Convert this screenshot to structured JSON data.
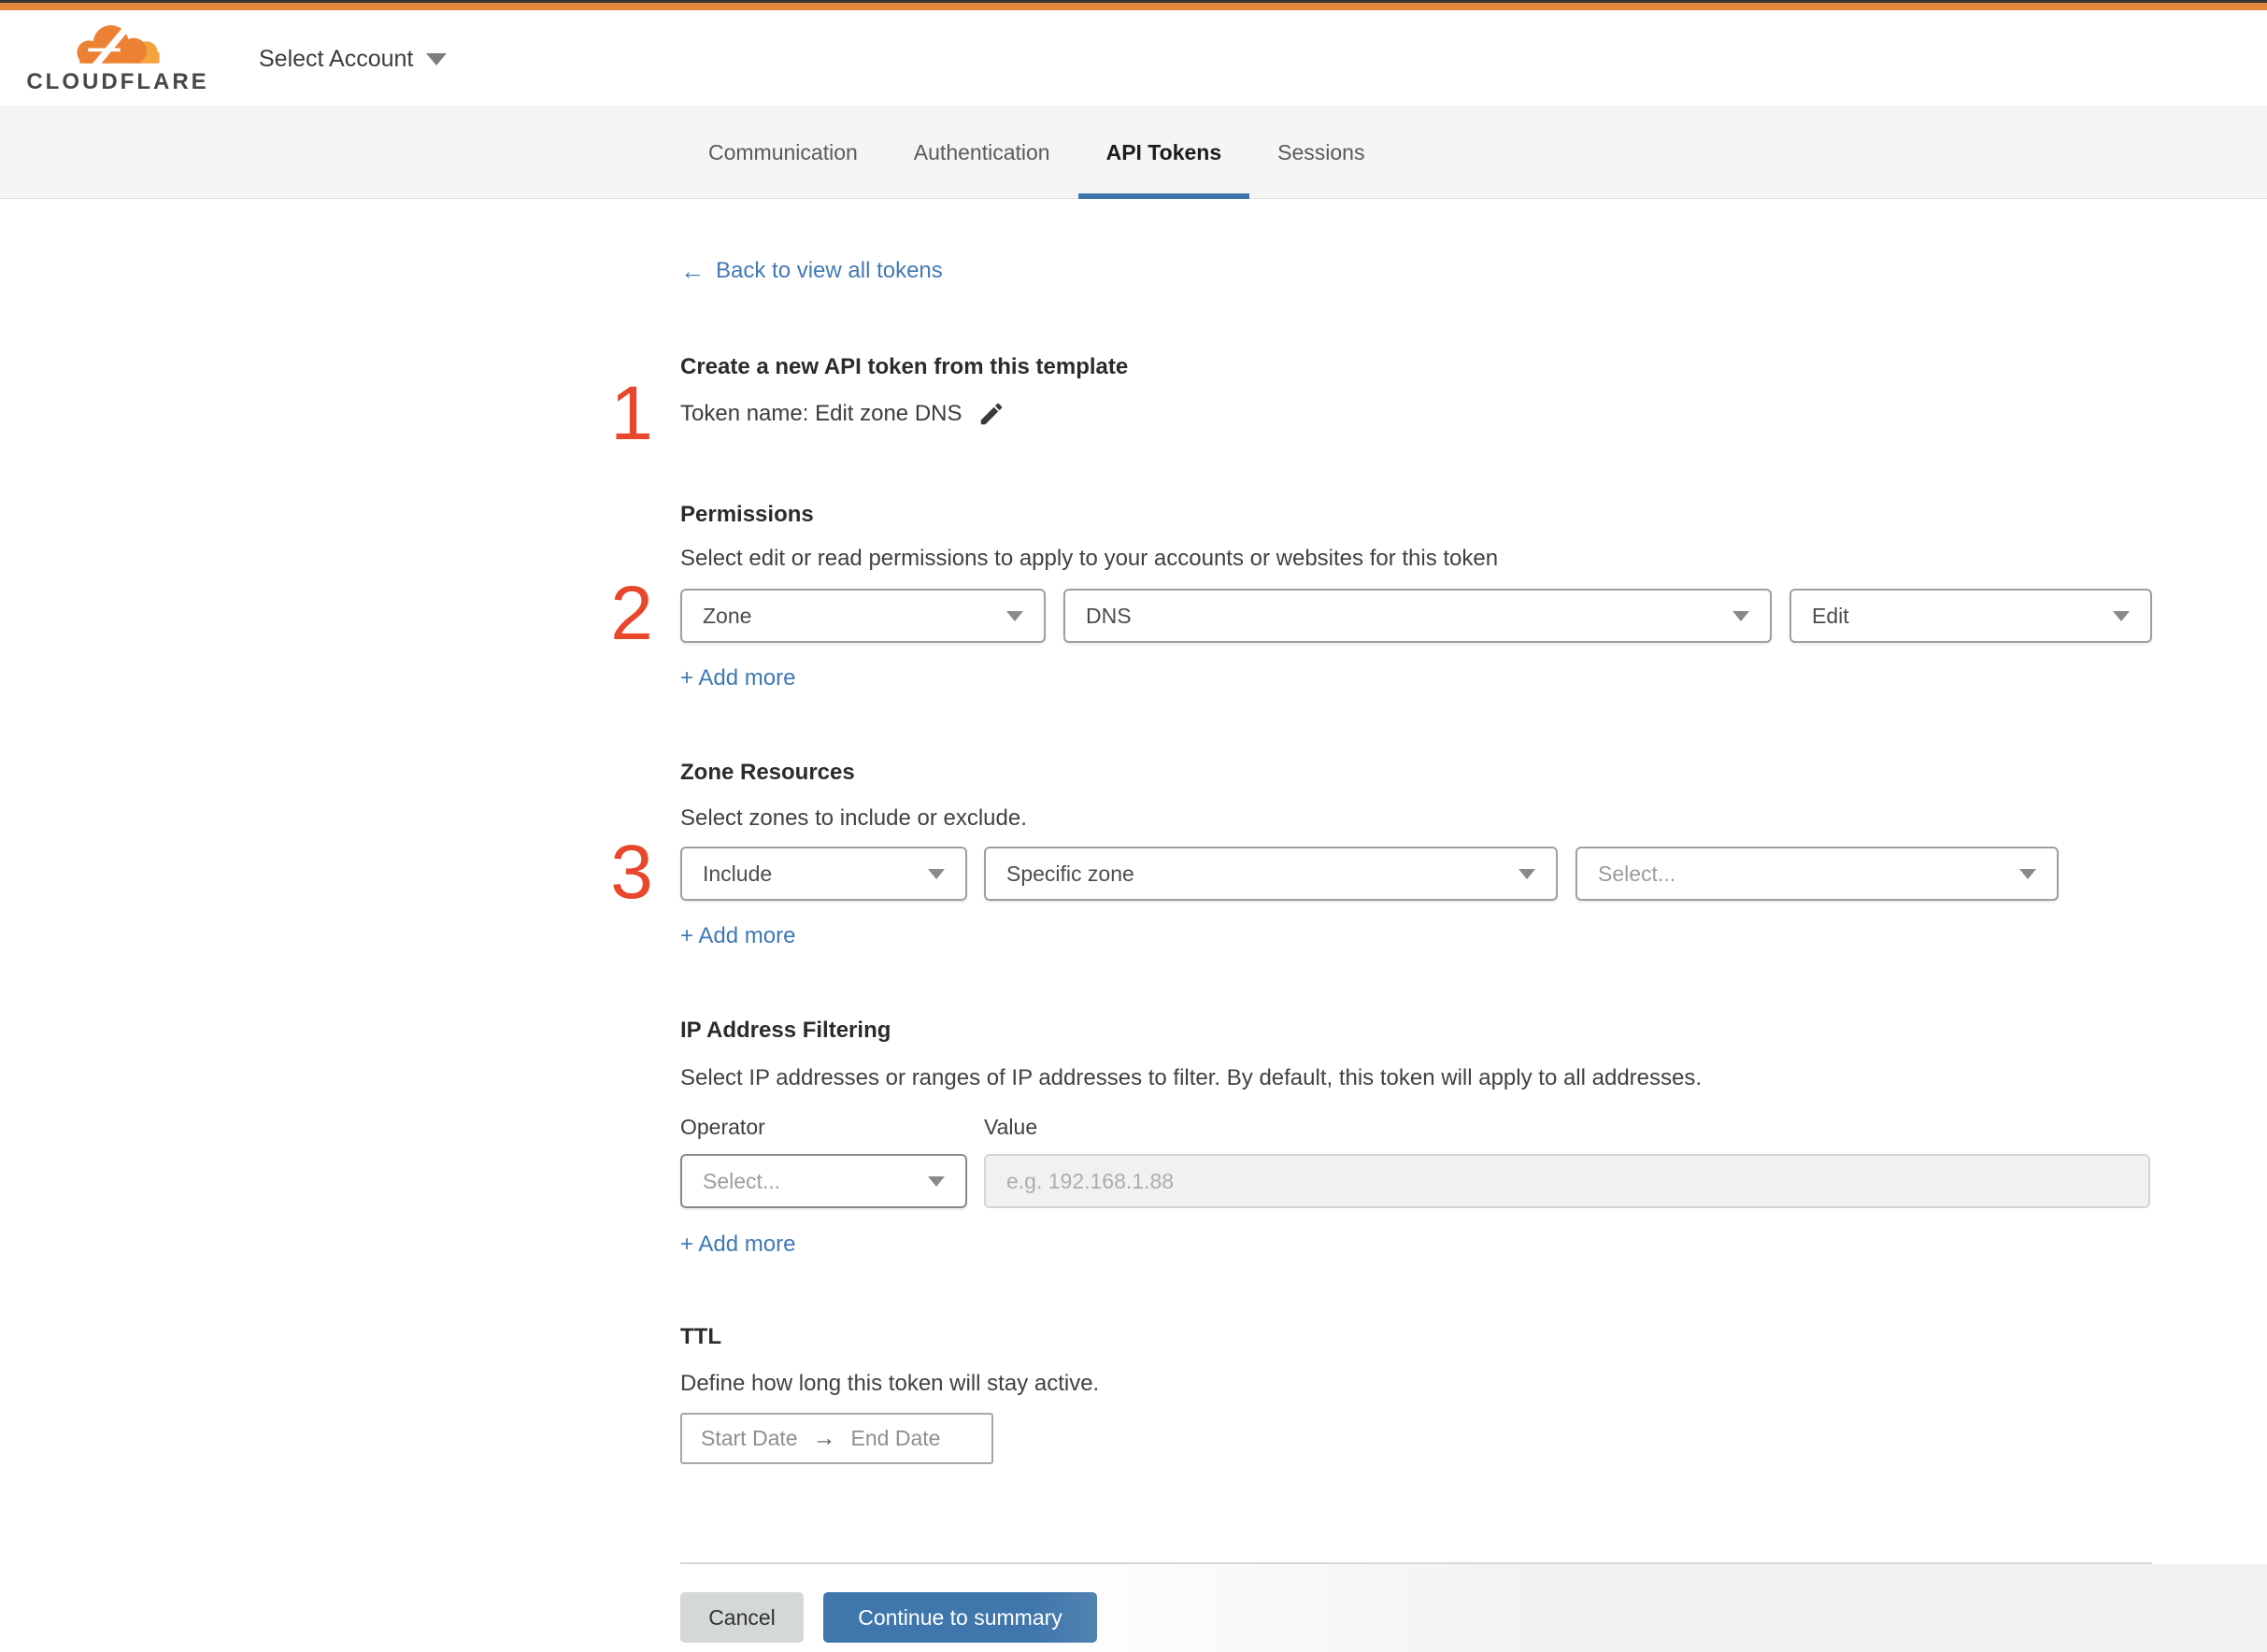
{
  "colors": {
    "top_bar_orange": "#e2873b",
    "top_bar_dark": "#3b3834",
    "link_blue": "#4379b4",
    "primary_button_blue": "#3f76ab",
    "tab_underline_blue": "#3f76ab",
    "step_number_red": "#e8472b"
  },
  "header": {
    "logo_text": "CLOUDFLARE",
    "account_selector_label": "Select Account"
  },
  "tabs": [
    {
      "label": "Communication"
    },
    {
      "label": "Authentication"
    },
    {
      "label": "API Tokens"
    },
    {
      "label": "Sessions"
    }
  ],
  "back": {
    "arrow": "←",
    "label": "Back to view all tokens"
  },
  "add_more": "+ Add more",
  "template_section": {
    "number": "1",
    "title": "Create a new API token from this template",
    "token_name": "Token name: Edit zone DNS"
  },
  "permissions": {
    "number": "2",
    "title": "Permissions",
    "description": "Select edit or read permissions to apply to your accounts or websites for this token",
    "scope": "Zone",
    "resource": "DNS",
    "access": "Edit"
  },
  "zone_resources": {
    "number": "3",
    "title": "Zone Resources",
    "description": "Select zones to include or exclude.",
    "operator": "Include",
    "type": "Specific zone",
    "zone_placeholder": "Select..."
  },
  "ip_filtering": {
    "title": "IP Address Filtering",
    "description": "Select IP addresses or ranges of IP addresses to filter. By default, this token will apply to all addresses.",
    "operator_label": "Operator",
    "value_label": "Value",
    "operator_placeholder": "Select...",
    "value_placeholder": "e.g. 192.168.1.88"
  },
  "ttl": {
    "title": "TTL",
    "description": "Define how long this token will stay active.",
    "start_date": "Start Date",
    "arrow": "→",
    "end_date": "End Date"
  },
  "footer": {
    "cancel": "Cancel",
    "continue": "Continue to summary"
  }
}
